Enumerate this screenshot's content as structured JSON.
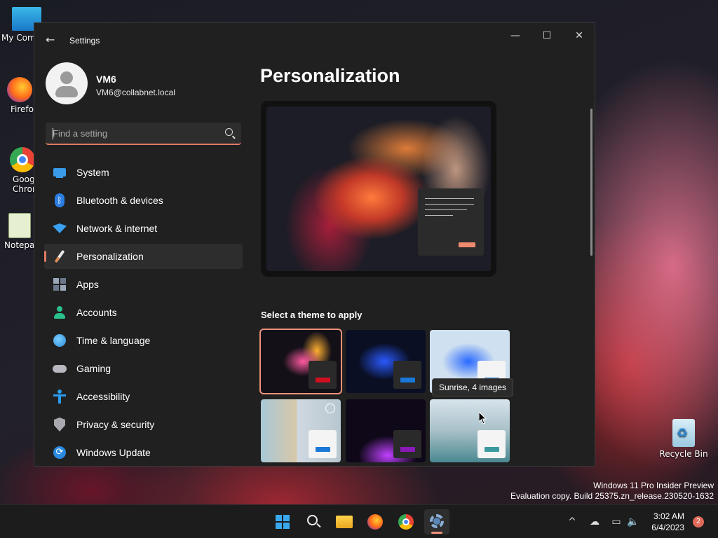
{
  "desktop": {
    "icons": [
      {
        "label": "My Com"
      },
      {
        "label": "Firefo"
      },
      {
        "label": "Goog\nChron"
      },
      {
        "label": "Notepa"
      },
      {
        "label": "Recycle Bin"
      }
    ]
  },
  "window": {
    "title": "Settings",
    "controls": {
      "minimize": "—",
      "maximize": "☐",
      "close": "✕"
    }
  },
  "profile": {
    "name": "VM6",
    "email": "VM6@collabnet.local"
  },
  "search": {
    "placeholder": "Find a setting",
    "value": ""
  },
  "nav": {
    "items": [
      {
        "label": "System",
        "icon": "system-icon"
      },
      {
        "label": "Bluetooth & devices",
        "icon": "bluetooth-icon"
      },
      {
        "label": "Network & internet",
        "icon": "network-icon"
      },
      {
        "label": "Personalization",
        "icon": "brush-icon",
        "active": true
      },
      {
        "label": "Apps",
        "icon": "apps-icon"
      },
      {
        "label": "Accounts",
        "icon": "accounts-icon"
      },
      {
        "label": "Time & language",
        "icon": "globe-clock-icon"
      },
      {
        "label": "Gaming",
        "icon": "gamepad-icon"
      },
      {
        "label": "Accessibility",
        "icon": "accessibility-icon"
      },
      {
        "label": "Privacy & security",
        "icon": "shield-icon"
      },
      {
        "label": "Windows Update",
        "icon": "update-icon"
      }
    ]
  },
  "main": {
    "title": "Personalization",
    "theme_heading": "Select a theme to apply",
    "tooltip": "Sunrise, 4 images",
    "themes": [
      {
        "name": "theme-1",
        "selected": true
      },
      {
        "name": "theme-2"
      },
      {
        "name": "theme-3"
      },
      {
        "name": "theme-4"
      },
      {
        "name": "theme-5"
      },
      {
        "name": "theme-6"
      }
    ]
  },
  "watermark": {
    "line1": "Windows 11 Pro Insider Preview",
    "line2": "Evaluation copy. Build 25375.zn_release.230520-1632"
  },
  "taskbar": {
    "time": "3:02 AM",
    "date": "6/4/2023",
    "notifications": "2"
  },
  "colors": {
    "accent": "#e07b63",
    "window_bg": "#202020",
    "taskbar_bg": "#1c1c1c"
  }
}
